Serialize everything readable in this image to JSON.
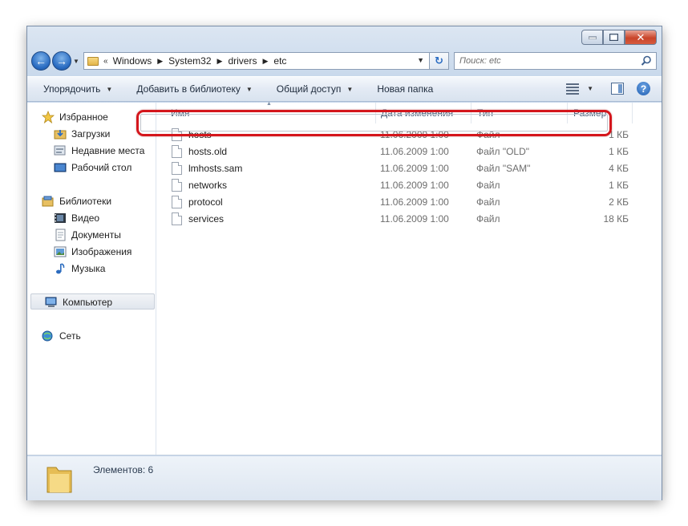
{
  "address": {
    "overflow": "«",
    "crumbs": [
      "Windows",
      "System32",
      "drivers",
      "etc"
    ]
  },
  "search": {
    "placeholder": "Поиск: etc"
  },
  "toolbar": {
    "organize": "Упорядочить",
    "add_to_library": "Добавить в библиотеку",
    "share": "Общий доступ",
    "new_folder": "Новая папка"
  },
  "sidebar": {
    "favorites": "Избранное",
    "downloads": "Загрузки",
    "recent": "Недавние места",
    "desktop": "Рабочий стол",
    "libraries": "Библиотеки",
    "video": "Видео",
    "documents": "Документы",
    "images": "Изображения",
    "music": "Музыка",
    "computer": "Компьютер",
    "network": "Сеть"
  },
  "columns": {
    "name": "Имя",
    "date": "Дата изменения",
    "type": "Тип",
    "size": "Размер"
  },
  "files": [
    {
      "name": "hosts",
      "date": "11.06.2009 1:00",
      "type": "Файл",
      "size": "1 КБ"
    },
    {
      "name": "hosts.old",
      "date": "11.06.2009 1:00",
      "type": "Файл \"OLD\"",
      "size": "1 КБ"
    },
    {
      "name": "lmhosts.sam",
      "date": "11.06.2009 1:00",
      "type": "Файл \"SAM\"",
      "size": "4 КБ"
    },
    {
      "name": "networks",
      "date": "11.06.2009 1:00",
      "type": "Файл",
      "size": "1 КБ"
    },
    {
      "name": "protocol",
      "date": "11.06.2009 1:00",
      "type": "Файл",
      "size": "2 КБ"
    },
    {
      "name": "services",
      "date": "11.06.2009 1:00",
      "type": "Файл",
      "size": "18 КБ"
    }
  ],
  "status": {
    "items_count": "Элементов: 6"
  },
  "colors": {
    "highlight": "#d4161c",
    "accent": "#2a6cc2"
  }
}
